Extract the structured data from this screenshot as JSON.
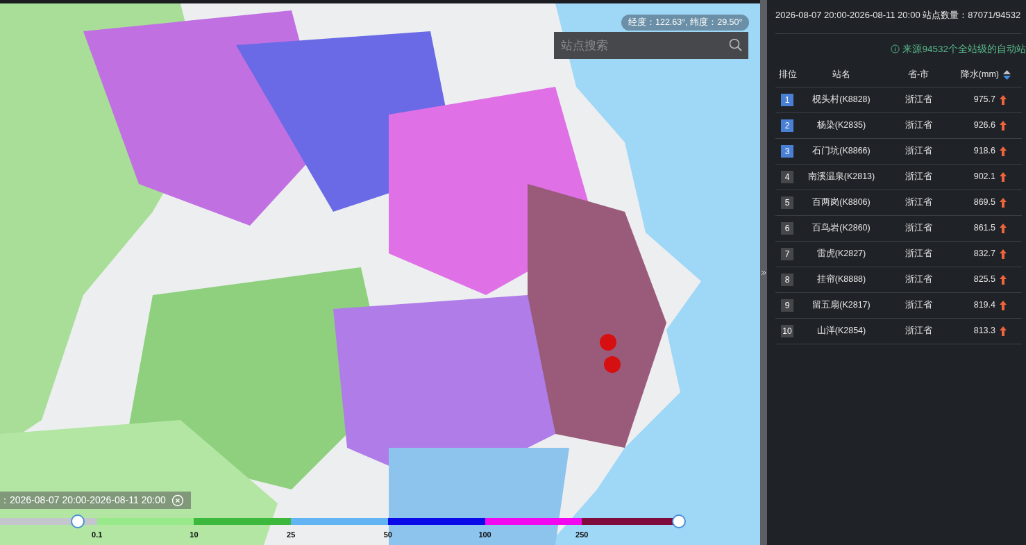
{
  "map": {
    "kind": "picture",
    "coordinates": "经度：122.63°, 纬度：29.50°",
    "search": {
      "placeholder": "站点搜索"
    },
    "time_label": "：2026-08-07 20:00-2026-08-11 20:00",
    "legend": {
      "low": {
        "level": 0.115
      },
      "high": {
        "level": 1
      },
      "segments": [
        {
          "color": "#c3c6cc"
        },
        {
          "color": "#98e98a"
        },
        {
          "color": "#3cb93c"
        },
        {
          "color": "#62b4f2"
        },
        {
          "color": "#0a0ae8"
        },
        {
          "color": "#f208ee"
        },
        {
          "color": "#7f0a3c"
        }
      ],
      "ticks": [
        "0.1",
        "10",
        "25",
        "50",
        "100",
        "250"
      ]
    }
  },
  "panel": {
    "summary": "2026-08-07 20:00-2026-08-11 20:00  站点数量：87071/94532",
    "source_note": "来源94532个全站级的自动站",
    "columns": [
      "排位",
      "站名",
      "省-市",
      "降水(mm)"
    ],
    "rows": [
      {
        "rank": "1",
        "color": "#4a7fd6",
        "name": "枧头村(K8828)",
        "province": "浙江省",
        "rain": "975.7"
      },
      {
        "rank": "2",
        "color": "#4a7fd6",
        "name": "杨染(K2835)",
        "province": "浙江省",
        "rain": "926.6"
      },
      {
        "rank": "3",
        "color": "#4a7fd6",
        "name": "石门坑(K8866)",
        "province": "浙江省",
        "rain": "918.6"
      },
      {
        "rank": "4",
        "color": "#45474b",
        "name": "南溪温泉(K2813)",
        "province": "浙江省",
        "rain": "902.1"
      },
      {
        "rank": "5",
        "color": "#45474b",
        "name": "百两岗(K8806)",
        "province": "浙江省",
        "rain": "869.5"
      },
      {
        "rank": "6",
        "color": "#45474b",
        "name": "百鸟岩(K2860)",
        "province": "浙江省",
        "rain": "861.5"
      },
      {
        "rank": "7",
        "color": "#45474b",
        "name": "雷虎(K2827)",
        "province": "浙江省",
        "rain": "832.7"
      },
      {
        "rank": "8",
        "color": "#45474b",
        "name": "挂帘(K8888)",
        "province": "浙江省",
        "rain": "825.5"
      },
      {
        "rank": "9",
        "color": "#45474b",
        "name": "留五扇(K2817)",
        "province": "浙江省",
        "rain": "819.4"
      },
      {
        "rank": "10",
        "color": "#45474b",
        "name": "山洋(K2854)",
        "province": "浙江省",
        "rain": "813.3"
      }
    ]
  }
}
